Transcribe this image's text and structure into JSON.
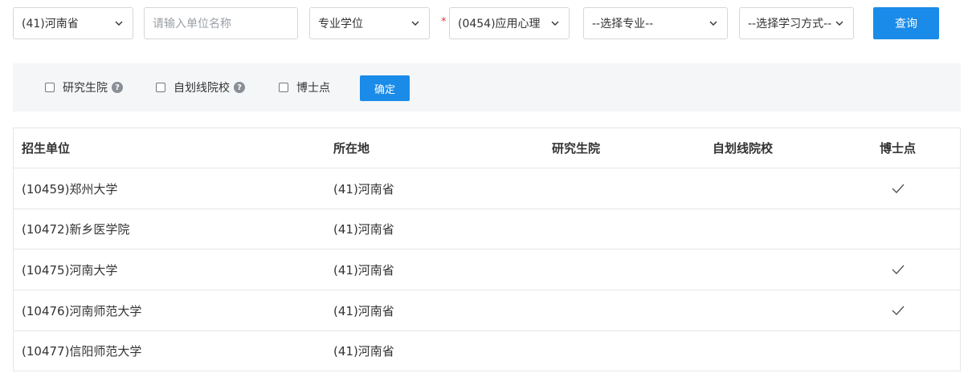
{
  "filters": {
    "province": "(41)河南省",
    "unit_placeholder": "请输入单位名称",
    "degree_type": "专业学位",
    "required_mark": "*",
    "subject": "(0454)应用心理",
    "major": "--选择专业--",
    "study_mode": "--选择学习方式--",
    "query_label": "查询"
  },
  "checkboxes": [
    {
      "label": "研究生院",
      "help": true
    },
    {
      "label": "自划线院校",
      "help": true
    },
    {
      "label": "博士点",
      "help": false
    }
  ],
  "confirm_label": "确定",
  "table": {
    "headers": [
      "招生单位",
      "所在地",
      "研究生院",
      "自划线院校",
      "博士点"
    ],
    "rows": [
      {
        "unit": "(10459)郑州大学",
        "location": "(41)河南省",
        "doctoral": true
      },
      {
        "unit": "(10472)新乡医学院",
        "location": "(41)河南省",
        "doctoral": false
      },
      {
        "unit": "(10475)河南大学",
        "location": "(41)河南省",
        "doctoral": true
      },
      {
        "unit": "(10476)河南师范大学",
        "location": "(41)河南省",
        "doctoral": true
      },
      {
        "unit": "(10477)信阳师范大学",
        "location": "(41)河南省",
        "doctoral": false
      }
    ]
  },
  "icons": {
    "dropdown": "chevron-down-icon",
    "help": "question-circle-icon",
    "doctoral": "check-icon"
  }
}
